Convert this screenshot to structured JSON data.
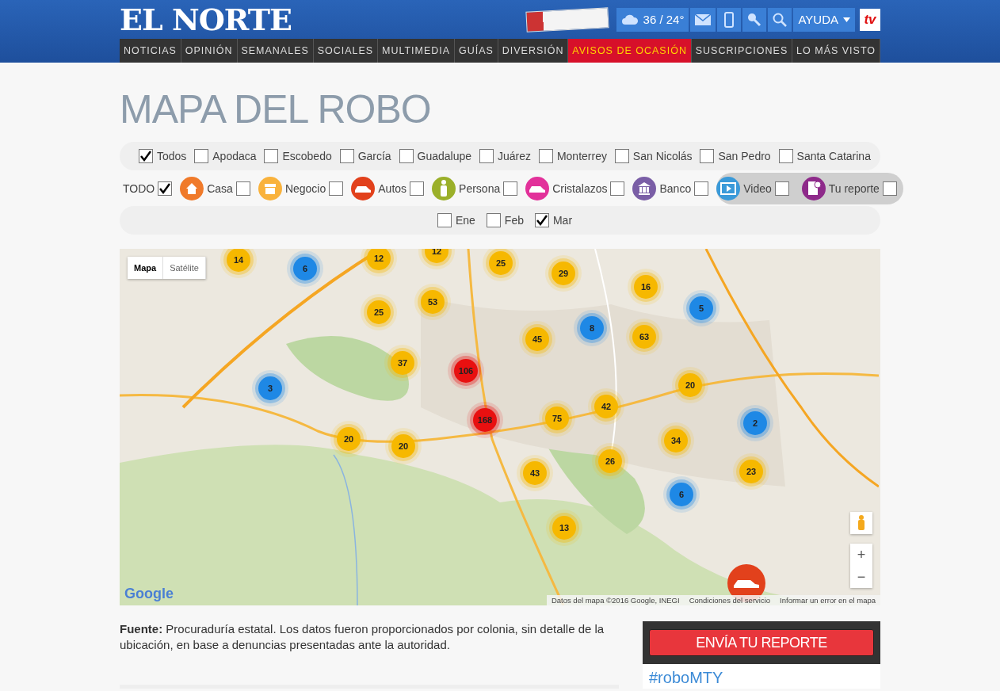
{
  "header": {
    "logo": "EL NORTE",
    "weather": "36 / 24°",
    "help": "AYUDA",
    "tv": "tv"
  },
  "nav": [
    {
      "label": "NOTICIAS",
      "selected": false
    },
    {
      "label": "OPINIÓN",
      "selected": false
    },
    {
      "label": "SEMANALES",
      "selected": false
    },
    {
      "label": "SOCIALES",
      "selected": false
    },
    {
      "label": "MULTIMEDIA",
      "selected": false
    },
    {
      "label": "GUÍAS",
      "selected": false
    },
    {
      "label": "DIVERSIÓN",
      "selected": false
    },
    {
      "label": "AVISOS DE OCASIÓN",
      "selected": true
    },
    {
      "label": "SUSCRIPCIONES",
      "selected": false
    },
    {
      "label": "LO MÁS VISTO",
      "selected": false
    }
  ],
  "title": "MAPA DEL ROBO",
  "municipalities": [
    {
      "label": "Todos",
      "checked": true
    },
    {
      "label": "Apodaca",
      "checked": false
    },
    {
      "label": "Escobedo",
      "checked": false
    },
    {
      "label": "García",
      "checked": false
    },
    {
      "label": "Guadalupe",
      "checked": false
    },
    {
      "label": "Juárez",
      "checked": false
    },
    {
      "label": "Monterrey",
      "checked": false
    },
    {
      "label": "San Nicolás",
      "checked": false
    },
    {
      "label": "San Pedro",
      "checked": false
    },
    {
      "label": "Santa Catarina",
      "checked": false
    }
  ],
  "all_types": {
    "label": "TODO",
    "checked": true
  },
  "types": [
    {
      "kind": "house",
      "label": "Casa",
      "checked": false,
      "color": "#f07a2a"
    },
    {
      "kind": "store",
      "label": "Negocio",
      "checked": false,
      "color": "#f9b23c"
    },
    {
      "kind": "car",
      "label": "Autos",
      "checked": false,
      "color": "#e2411c"
    },
    {
      "kind": "person",
      "label": "Persona",
      "checked": false,
      "color": "#9bb02a"
    },
    {
      "kind": "car",
      "label": "Cristalazos",
      "checked": false,
      "color": "#e2319a"
    },
    {
      "kind": "bank",
      "label": "Banco",
      "checked": false,
      "color": "#7a5ea6"
    }
  ],
  "extras": [
    {
      "kind": "video",
      "label": "Video",
      "checked": false,
      "color": "#3a9ad9"
    },
    {
      "kind": "report",
      "label": "Tu reporte",
      "checked": false,
      "color": "#8e2a8a"
    }
  ],
  "months": [
    {
      "label": "Ene",
      "checked": false
    },
    {
      "label": "Feb",
      "checked": false
    },
    {
      "label": "Mar",
      "checked": true
    }
  ],
  "map": {
    "tabs": [
      {
        "label": "Mapa",
        "selected": true
      },
      {
        "label": "Satélite",
        "selected": false
      }
    ],
    "logo": "Google",
    "attribution": "Datos del mapa ©2016 Google, INEGI",
    "terms": "Condiciones del servicio",
    "report_error": "Informar un error en el mapa",
    "zoom_in": "+",
    "zoom_out": "−",
    "clusters": [
      {
        "count": "14",
        "color": "#f6b800"
      },
      {
        "count": "6",
        "color": "#1e88e5"
      },
      {
        "count": "12",
        "color": "#f6b800"
      },
      {
        "count": "12",
        "color": "#f6b800"
      },
      {
        "count": "25",
        "color": "#f6b800"
      },
      {
        "count": "29",
        "color": "#f6b800"
      },
      {
        "count": "16",
        "color": "#f6b800"
      },
      {
        "count": "5",
        "color": "#1e88e5"
      },
      {
        "count": "25",
        "color": "#f6b800"
      },
      {
        "count": "53",
        "color": "#f6b800"
      },
      {
        "count": "8",
        "color": "#1e88e5"
      },
      {
        "count": "63",
        "color": "#f6b800"
      },
      {
        "count": "45",
        "color": "#f6b800"
      },
      {
        "count": "37",
        "color": "#f6b800"
      },
      {
        "count": "106",
        "color": "#e81010"
      },
      {
        "count": "20",
        "color": "#f6b800"
      },
      {
        "count": "3",
        "color": "#1e88e5"
      },
      {
        "count": "42",
        "color": "#f6b800"
      },
      {
        "count": "75",
        "color": "#f6b800"
      },
      {
        "count": "168",
        "color": "#e81010"
      },
      {
        "count": "2",
        "color": "#1e88e5"
      },
      {
        "count": "20",
        "color": "#f6b800"
      },
      {
        "count": "20",
        "color": "#f6b800"
      },
      {
        "count": "34",
        "color": "#f6b800"
      },
      {
        "count": "26",
        "color": "#f6b800"
      },
      {
        "count": "23",
        "color": "#f6b800"
      },
      {
        "count": "43",
        "color": "#f6b800"
      },
      {
        "count": "6",
        "color": "#1e88e5"
      },
      {
        "count": "13",
        "color": "#f6b800"
      }
    ]
  },
  "source": "**Fuente:** Procuraduría estatal. Los datos fueron proporcionados por colonia, sin detalle de la ubicación, en base a denuncias presentadas ante la autoridad.",
  "sidebar": {
    "button": "ENVÍA TU REPORTE",
    "hashtag": "#roboMTY"
  }
}
